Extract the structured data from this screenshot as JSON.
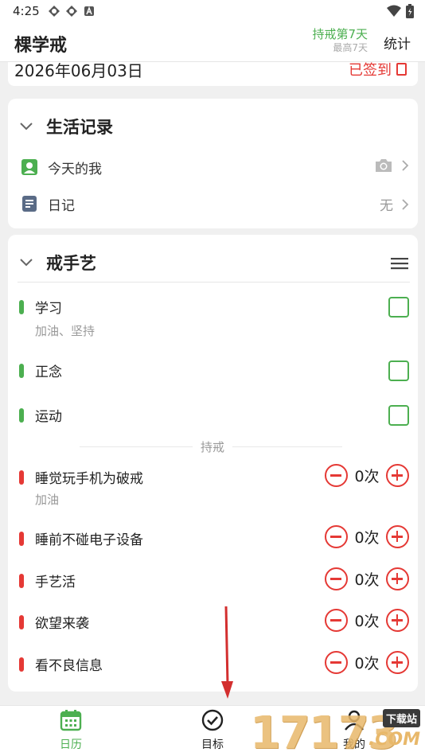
{
  "status": {
    "time": "4:25"
  },
  "header": {
    "title": "棵学戒",
    "streak_main": "持戒第7天",
    "streak_sub": "最高7天",
    "stats_label": "统计"
  },
  "date_card": {
    "date": "2026年06月03日",
    "signed_label": "已签到"
  },
  "life_section": {
    "title": "生活记录",
    "items": [
      {
        "label": "今天的我",
        "value": ""
      },
      {
        "label": "日记",
        "value": "无"
      }
    ]
  },
  "craft_section": {
    "title": "戒手艺",
    "goals": [
      {
        "name": "学习",
        "note": "加油、坚持"
      },
      {
        "name": "正念",
        "note": ""
      },
      {
        "name": "运动",
        "note": ""
      }
    ],
    "divider_label": "持戒",
    "abstains": [
      {
        "name": "睡觉玩手机为破戒",
        "note": "加油",
        "count": "0次"
      },
      {
        "name": "睡前不碰电子设备",
        "note": "",
        "count": "0次"
      },
      {
        "name": "手艺活",
        "note": "",
        "count": "0次"
      },
      {
        "name": "欲望来袭",
        "note": "",
        "count": "0次"
      },
      {
        "name": "看不良信息",
        "note": "",
        "count": "0次"
      }
    ]
  },
  "nav": {
    "items": [
      {
        "label": "日历"
      },
      {
        "label": "目标"
      },
      {
        "label": "我的"
      }
    ]
  },
  "watermark": {
    "digits": "17173",
    "tag": "下载站",
    "domain": ".COM"
  },
  "colors": {
    "accent_green": "#4caf50",
    "accent_red": "#e53935"
  },
  "icons": [
    "calendar-icon",
    "check-circle-icon",
    "person-icon",
    "camera-icon",
    "diary-icon",
    "menu-icon"
  ]
}
